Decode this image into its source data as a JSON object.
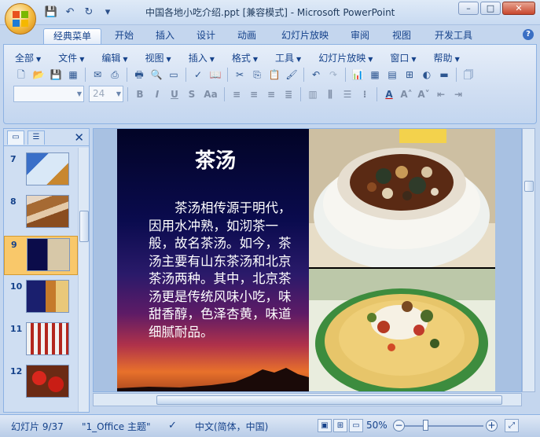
{
  "window": {
    "title": "中国各地小吃介绍.ppt [兼容模式] - Microsoft PowerPoint",
    "buttons": {
      "minimize": "–",
      "maximize": "□",
      "close": "✕"
    }
  },
  "quick_access": [
    "save-icon",
    "undo-icon",
    "redo-icon",
    "customize-icon"
  ],
  "tabs": [
    {
      "label": "经典菜单",
      "active": true
    },
    {
      "label": "开始"
    },
    {
      "label": "插入"
    },
    {
      "label": "设计"
    },
    {
      "label": "动画"
    },
    {
      "label": "幻灯片放映"
    },
    {
      "label": "审阅"
    },
    {
      "label": "视图"
    },
    {
      "label": "开发工具"
    }
  ],
  "menus": [
    "全部",
    "文件",
    "编辑",
    "视图",
    "插入",
    "格式",
    "工具",
    "幻灯片放映",
    "窗口",
    "帮助"
  ],
  "font": {
    "name": "",
    "size": "24"
  },
  "panel": {
    "close": "✕"
  },
  "slides": [
    {
      "num": "7"
    },
    {
      "num": "8"
    },
    {
      "num": "9",
      "selected": true
    },
    {
      "num": "10"
    },
    {
      "num": "11"
    },
    {
      "num": "12"
    }
  ],
  "current_slide": {
    "title": "茶汤",
    "body": "茶汤相传源于明代，因用水冲熟，如沏茶一般，故名茶汤。如今，茶汤主要有山东茶汤和北京茶汤两种。其中，北京茶汤更是传统风味小吃，味甜香醇，色泽杏黄，味道细腻耐品。"
  },
  "status": {
    "slide_info": "幻灯片 9/37",
    "theme": "\"1_Office 主题\"",
    "language": "中文(简体，中国)",
    "zoom": "50%",
    "zoom_minus": "−",
    "zoom_plus": "+"
  },
  "colors": {
    "ribbon_bg": "#d0def2",
    "accent_text": "#15428b",
    "selected_slide": "#f9c86a"
  }
}
